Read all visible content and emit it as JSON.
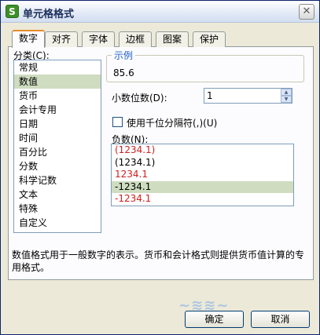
{
  "window": {
    "title": "单元格格式",
    "app_icon_glyph": "S"
  },
  "tabs": [
    {
      "label": "数字",
      "active": true
    },
    {
      "label": "对齐"
    },
    {
      "label": "字体"
    },
    {
      "label": "边框"
    },
    {
      "label": "图案"
    },
    {
      "label": "保护"
    }
  ],
  "category": {
    "label": "分类(C):",
    "items": [
      "常规",
      "数值",
      "货币",
      "会计专用",
      "日期",
      "时间",
      "百分比",
      "分数",
      "科学记数",
      "文本",
      "特殊",
      "自定义"
    ],
    "selected_index": 1
  },
  "sample": {
    "legend": "示例",
    "value": "85.6"
  },
  "decimal": {
    "label": "小数位数(D):",
    "value": "1"
  },
  "thousands": {
    "label": "使用千位分隔符(,)(U)",
    "checked": false
  },
  "negative": {
    "label": "负数(N):",
    "items": [
      {
        "text": "(1234.1)",
        "color": "#d21e1e"
      },
      {
        "text": "(1234.1)",
        "color": "#000000"
      },
      {
        "text": "1234.1",
        "color": "#d21e1e"
      },
      {
        "text": "-1234.1",
        "color": "#000000"
      },
      {
        "text": "-1234.1",
        "color": "#d21e1e"
      }
    ],
    "selected_index": 3
  },
  "description": "数值格式用于一般数字的表示。货币和会计格式则提供货币值计算的专用格式。",
  "buttons": {
    "ok": "确定",
    "cancel": "取消"
  }
}
